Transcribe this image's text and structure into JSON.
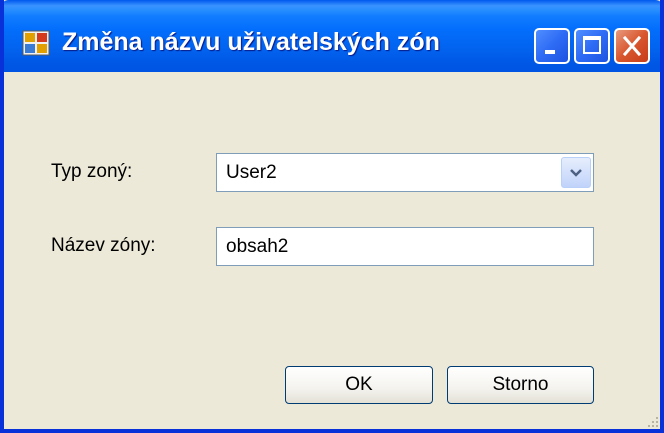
{
  "window": {
    "title": "Změna názvu uživatelských zón",
    "title_bar_color": "#0054E3",
    "background_color": "#ECE9D8"
  },
  "titlebar_buttons": {
    "minimize_icon": "minimize-icon",
    "maximize_icon": "maximize-icon",
    "close_icon": "close-icon"
  },
  "form": {
    "zone_type": {
      "label": "Typ zoný:",
      "selected_value": "User2"
    },
    "zone_name": {
      "label": "Název zóny:",
      "value": "obsah2"
    }
  },
  "buttons": {
    "ok_label": "OK",
    "cancel_label": "Storno"
  }
}
